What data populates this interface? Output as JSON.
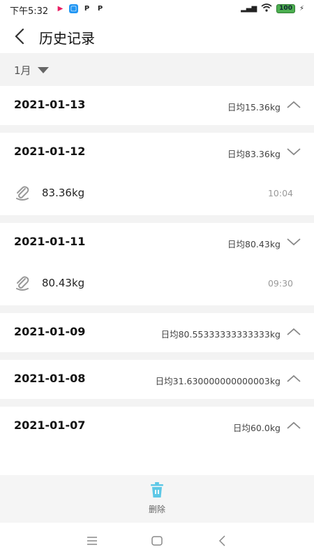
{
  "status_bar": {
    "time": "下午5:32",
    "battery": "100"
  },
  "header": {
    "title": "历史记录"
  },
  "filter": {
    "month": "1月"
  },
  "days": [
    {
      "date": "2021-01-13",
      "avg": "日均15.36kg",
      "expanded": false,
      "entries": []
    },
    {
      "date": "2021-01-12",
      "avg": "日均83.36kg",
      "expanded": true,
      "entries": [
        {
          "weight": "83.36kg",
          "time": "10:04"
        }
      ]
    },
    {
      "date": "2021-01-11",
      "avg": "日均80.43kg",
      "expanded": true,
      "entries": [
        {
          "weight": "80.43kg",
          "time": "09:30"
        }
      ]
    },
    {
      "date": "2021-01-09",
      "avg": "日均80.55333333333333kg",
      "expanded": false,
      "entries": []
    },
    {
      "date": "2021-01-08",
      "avg": "日均31.630000000000003kg",
      "expanded": false,
      "entries": []
    },
    {
      "date": "2021-01-07",
      "avg": "日均60.0kg",
      "expanded": false,
      "entries": []
    }
  ],
  "bottom": {
    "delete_label": "删除"
  },
  "colors": {
    "accent": "#5ec8e6",
    "background": "#f3f3f3"
  }
}
